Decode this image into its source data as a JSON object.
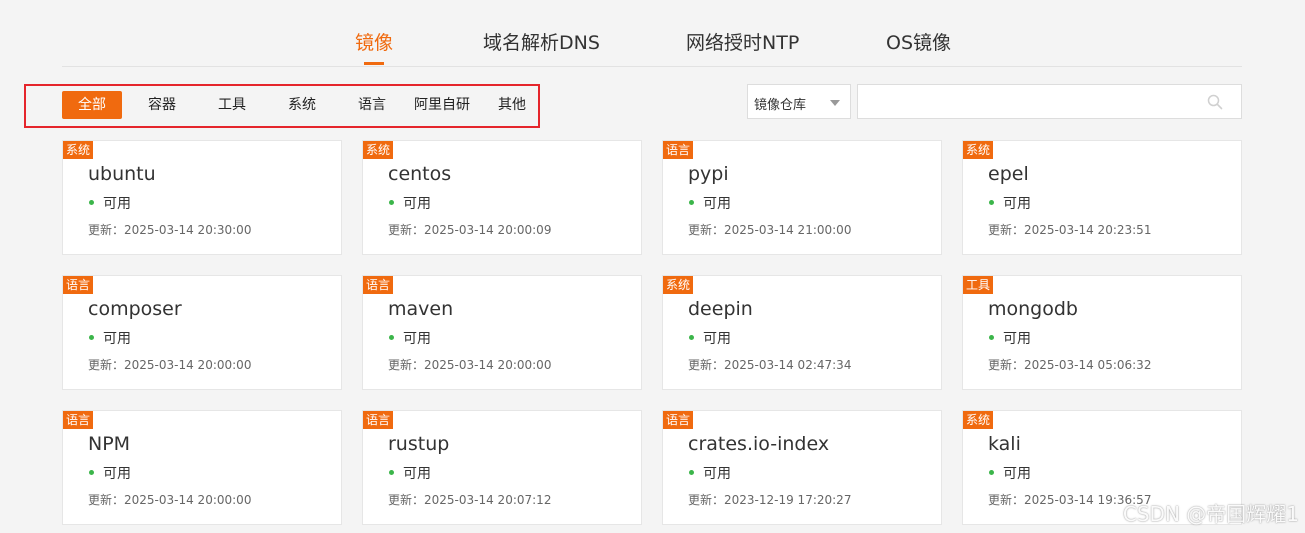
{
  "top_tabs": [
    "镜像",
    "域名解析DNS",
    "网络授时NTP",
    "OS镜像"
  ],
  "active_tab": 0,
  "filters": [
    "全部",
    "容器",
    "工具",
    "系统",
    "语言",
    "阿里自研",
    "其他"
  ],
  "active_filter": 0,
  "search": {
    "repo_select_value": "镜像仓库",
    "placeholder": ""
  },
  "cards": [
    {
      "badge": "系统",
      "name": "ubuntu",
      "status": "可用",
      "updated": "更新：2025-03-14 20:30:00"
    },
    {
      "badge": "系统",
      "name": "centos",
      "status": "可用",
      "updated": "更新：2025-03-14 20:00:09"
    },
    {
      "badge": "语言",
      "name": "pypi",
      "status": "可用",
      "updated": "更新：2025-03-14 21:00:00"
    },
    {
      "badge": "系统",
      "name": "epel",
      "status": "可用",
      "updated": "更新：2025-03-14 20:23:51"
    },
    {
      "badge": "语言",
      "name": "composer",
      "status": "可用",
      "updated": "更新：2025-03-14 20:00:00"
    },
    {
      "badge": "语言",
      "name": "maven",
      "status": "可用",
      "updated": "更新：2025-03-14 20:00:00"
    },
    {
      "badge": "系统",
      "name": "deepin",
      "status": "可用",
      "updated": "更新：2025-03-14 02:47:34"
    },
    {
      "badge": "工具",
      "name": "mongodb",
      "status": "可用",
      "updated": "更新：2025-03-14 05:06:32"
    },
    {
      "badge": "语言",
      "name": "NPM",
      "status": "可用",
      "updated": "更新：2025-03-14 20:00:00"
    },
    {
      "badge": "语言",
      "name": "rustup",
      "status": "可用",
      "updated": "更新：2025-03-14 20:07:12"
    },
    {
      "badge": "语言",
      "name": "crates.io-index",
      "status": "可用",
      "updated": "更新：2023-12-19 17:20:27"
    },
    {
      "badge": "系统",
      "name": "kali",
      "status": "可用",
      "updated": "更新：2025-03-14 19:36:57"
    }
  ],
  "watermark": "CSDN @帝国辉耀1",
  "colors": {
    "accent": "#f06a0f",
    "status_ok": "#3bb54a",
    "highlight_frame": "#e5252b"
  }
}
